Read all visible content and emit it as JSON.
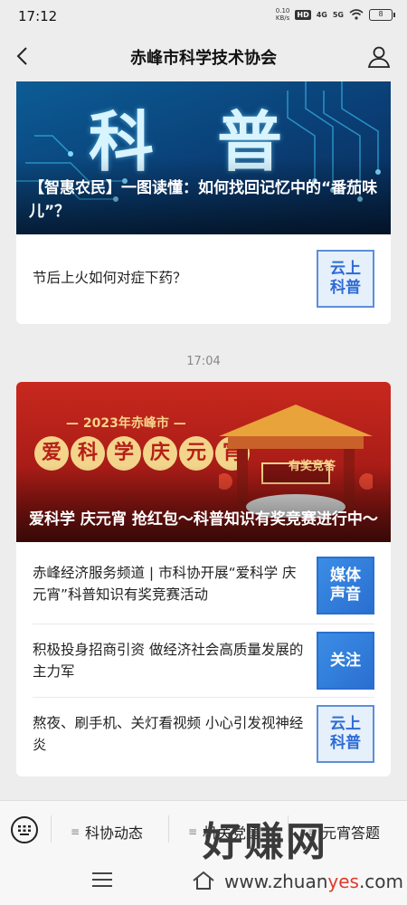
{
  "status_bar": {
    "time": "17:12",
    "net_speed_value": "0.10",
    "net_speed_unit": "KB/s",
    "hd_label": "HD",
    "signal1": "4G",
    "signal2": "5G",
    "battery": "8"
  },
  "nav": {
    "title": "赤峰市科学技术协会",
    "icons": [
      "back-icon",
      "profile-icon"
    ]
  },
  "card1": {
    "cover_art_text": "科普",
    "cover_title": "【智惠农民】一图读懂：如何找回记忆中的“番茄味儿”？",
    "items": [
      {
        "text": "节后上火如何对症下药？",
        "thumb": "云上科普"
      }
    ]
  },
  "timestamp": "17:04",
  "card2": {
    "cover_year": "— 2023年赤峰市 —",
    "cover_art_chars": [
      "爱",
      "科",
      "学",
      "庆",
      "元",
      "宵"
    ],
    "cover_sign": "有奖竞答",
    "cover_title": "爱科学 庆元宵 抢红包～科普知识有奖竞赛进行中～",
    "items": [
      {
        "text": "赤峰经济服务频道 | 市科协开展“爱科学 庆元宵”科普知识有奖竞赛活动",
        "thumb": "媒体声音"
      },
      {
        "text": "积极投身招商引资 做经济社会高质量发展的主力军",
        "thumb": "关注"
      },
      {
        "text": "熬夜、刷手机、关灯看视频 小心引发视神经炎",
        "thumb": "云上科普"
      }
    ]
  },
  "menu": {
    "items": [
      "科协动态",
      "机关党建",
      "元宵答题"
    ],
    "icons": [
      "keyboard-icon"
    ]
  },
  "watermark": {
    "title": "好赚网",
    "url_prefix": "www.zhuan",
    "url_highlight": "yes",
    "url_suffix": ".com"
  },
  "colors": {
    "background": "#ededed",
    "card": "#ffffff",
    "thumb_blue": "#2a6fd0",
    "cover_red": "#c8281e",
    "cover_blue": "#0c5c95"
  }
}
